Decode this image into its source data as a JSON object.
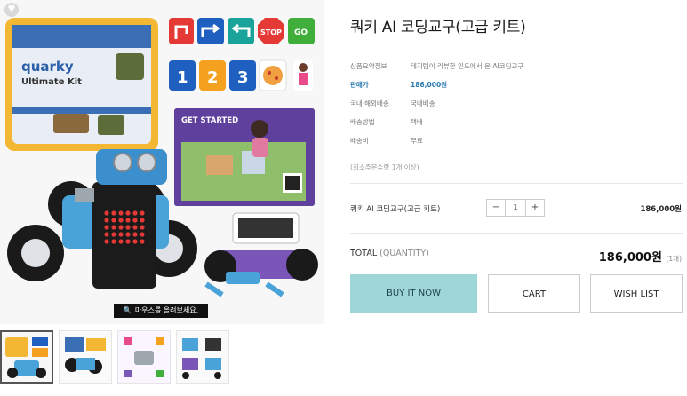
{
  "product": {
    "title": "쿼키 AI 코딩교구(고급 키트)"
  },
  "info": [
    {
      "key": "상품요약정보",
      "value": "테지템이 리뷰한 인도에서 온 AI코딩교구"
    },
    {
      "key": "판매가",
      "value": "186,000원"
    },
    {
      "key": "국내·해외배송",
      "value": "국내배송"
    },
    {
      "key": "배송방법",
      "value": "택배"
    },
    {
      "key": "배송비",
      "value": "무료"
    }
  ],
  "min_qty_note": "(최소주문수량 1개 이상)",
  "option": {
    "name": "쿼키 AI 코딩교구(고급 키트)",
    "minus": "−",
    "qty": "1",
    "plus": "+",
    "price": "186,000원"
  },
  "total": {
    "label": "TOTAL",
    "quantity_label": "(QUANTITY)",
    "price": "186,000원",
    "count": "(1개)"
  },
  "buttons": {
    "buy": "BUY IT NOW",
    "cart": "CART",
    "wish": "WISH LIST"
  },
  "gallery": {
    "zoom_hint": "마우스를 올려보세요.",
    "box_brand": "quarky",
    "box_name": "Ultimate Kit",
    "get_started": "GET STARTED",
    "signs": [
      "STOP",
      "GO"
    ],
    "numbers": [
      "1",
      "2",
      "3"
    ]
  },
  "colors": {
    "accent_price": "#2a7ab0",
    "buy_button": "#9fd6d8"
  }
}
